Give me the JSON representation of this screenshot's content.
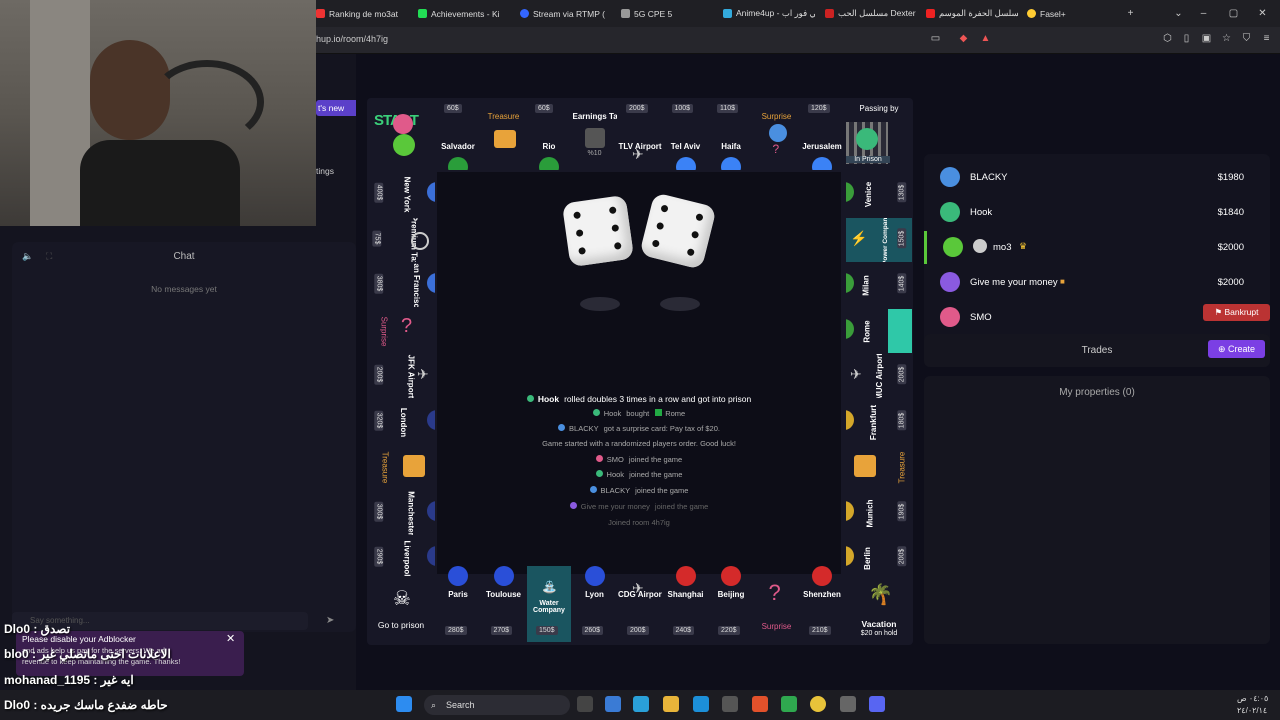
{
  "browser": {
    "tabs": [
      {
        "label": "Ranking de mo3at",
        "color": "#e33"
      },
      {
        "label": "Achievements - Ki",
        "color": "#2d5"
      },
      {
        "label": "Stream via RTMP (",
        "color": "#36f"
      },
      {
        "label": "5G CPE 5",
        "color": "#999"
      },
      {
        "label": "Anime4up - أنمي فور اب",
        "color": "#3ad"
      },
      {
        "label": "مسلسل الحب Dexter",
        "color": "#c22"
      },
      {
        "label": "مسلسل الحفرة الموسم",
        "color": "#e22"
      },
      {
        "label": "Fasel+",
        "color": "#fc3"
      }
    ],
    "url": "hup.io/room/4h7ig"
  },
  "left": {
    "new_game": "t's new",
    "settings": "tings",
    "chat_title": "Chat",
    "chat_empty": "No messages yet",
    "chat_placeholder": "Say something..."
  },
  "board": {
    "top": [
      {
        "name": "Salvador",
        "price": "60$",
        "flag": "#2a9d3a"
      },
      {
        "name": "Treasure",
        "price": "",
        "special": "treasure"
      },
      {
        "name": "Rio",
        "price": "60$",
        "flag": "#2a9d3a"
      },
      {
        "name": "Earnings Tax",
        "price": "",
        "sub": "%10"
      },
      {
        "name": "TLV Airport",
        "price": "200$"
      },
      {
        "name": "Tel Aviv",
        "price": "100$",
        "flag": "#3b82f6"
      },
      {
        "name": "Haifa",
        "price": "110$",
        "flag": "#3b82f6"
      },
      {
        "name": "Surprise",
        "price": ""
      },
      {
        "name": "Jerusalem",
        "price": "120$",
        "flag": "#3b82f6"
      }
    ],
    "corner_start": "START",
    "corner_prison": "Passing by",
    "corner_prison_sub": "In Prison",
    "left": [
      {
        "name": "New York",
        "price": "400$"
      },
      {
        "name": "Premium Tax",
        "price": "75$"
      },
      {
        "name": "San Francisco",
        "price": "380$"
      },
      {
        "name": "Surprise",
        "price": ""
      },
      {
        "name": "JFK Airport",
        "price": "200$"
      },
      {
        "name": "London",
        "price": "320$"
      },
      {
        "name": "Treasure",
        "price": ""
      },
      {
        "name": "Manchester",
        "price": "300$"
      },
      {
        "name": "Liverpool",
        "price": "290$"
      }
    ],
    "right": [
      {
        "name": "Venice",
        "price": "130$"
      },
      {
        "name": "Power Company",
        "price": "150$"
      },
      {
        "name": "Milan",
        "price": "140$"
      },
      {
        "name": "Rome",
        "price": ""
      },
      {
        "name": "MUC Airport",
        "price": "200$"
      },
      {
        "name": "Frankfurt",
        "price": "180$"
      },
      {
        "name": "Treasure",
        "price": ""
      },
      {
        "name": "Munich",
        "price": "190$"
      },
      {
        "name": "Berlin",
        "price": "200$"
      }
    ],
    "bottom": [
      {
        "name": "Paris",
        "price": "280$"
      },
      {
        "name": "Toulouse",
        "price": "270$"
      },
      {
        "name": "Water Company",
        "price": "150$"
      },
      {
        "name": "Lyon",
        "price": "260$"
      },
      {
        "name": "CDG Airport",
        "price": "200$"
      },
      {
        "name": "Shanghai",
        "price": "240$"
      },
      {
        "name": "Beijing",
        "price": "220$"
      },
      {
        "name": "Surprise",
        "price": ""
      },
      {
        "name": "Shenzhen",
        "price": "210$"
      }
    ],
    "corner_go_to_prison": "Go to prison",
    "corner_vacation": "Vacation",
    "corner_vacation_sub": "$20 on hold"
  },
  "log": [
    {
      "player": "Hook",
      "text": "rolled doubles 3 times in a row and got into prison",
      "color": "#3ab97a"
    },
    {
      "player": "Hook",
      "text": "bought",
      "extra": "Rome",
      "color": "#3ab97a"
    },
    {
      "player": "BLACKY",
      "text": "got a surprise card: Pay tax of $20.",
      "color": "#4a8fe0"
    },
    {
      "player": "",
      "text": "Game started with a randomized players order. Good luck!",
      "color": ""
    },
    {
      "player": "SMO",
      "text": "joined the game",
      "color": "#e05a8a"
    },
    {
      "player": "Hook",
      "text": "joined the game",
      "color": "#3ab97a"
    },
    {
      "player": "BLACKY",
      "text": "joined the game",
      "color": "#4a8fe0"
    },
    {
      "player": "Give me your money",
      "text": "joined the game",
      "color": "#8a5ae0"
    },
    {
      "player": "",
      "text": "Joined room 4h7ig",
      "color": ""
    }
  ],
  "players": [
    {
      "name": "BLACKY",
      "money": "$1980",
      "color": "#4a8fe0"
    },
    {
      "name": "Hook",
      "money": "$1840",
      "color": "#3ab97a"
    },
    {
      "name": "mo3",
      "money": "$2000",
      "color": "#5ac83a"
    },
    {
      "name": "Give me your money",
      "money": "$2000",
      "color": "#8a5ae0"
    },
    {
      "name": "SMO",
      "money": "$2000",
      "color": "#e05a8a"
    }
  ],
  "actions": {
    "bankrupt": "Bankrupt",
    "trades": "Trades",
    "create": "Create",
    "my_properties": "My properties (0)"
  },
  "overlay": {
    "ad_line1": "Please disable your Adblocker",
    "ad_line2": "and ads help us pay for the servers. We ad",
    "ad_line3": "revenue to keep maintaining the game. Thanks!",
    "chat1": "Dlo0 : تصدق",
    "chat2": "blo0 : الاعلانات احتى ماتصلي غير",
    "chat3": "mohanad_1195 : ايه غير",
    "chat4": "Dlo0 : حاطه ضفدع ماسك جريده"
  },
  "taskbar": {
    "search": "Search",
    "time": "٠٤:٠٥ ص",
    "date": "٢٤/٠٢/١٤"
  }
}
